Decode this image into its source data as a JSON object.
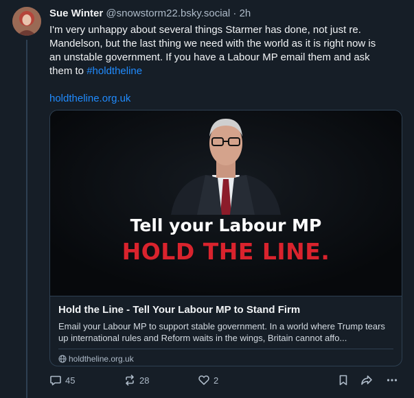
{
  "post": {
    "author_name": "Sue Winter",
    "author_handle": "@snowstorm22.bsky.social",
    "separator": "·",
    "time": "2h",
    "text_line1": "I'm very unhappy about several things Starmer has done, not just re.",
    "text_line2": "Mandelson, but the last thing we need with the world as it is right now is",
    "text_line3": "an unstable government. If you have a Labour MP email them and ask",
    "text_line4_prefix": "them to ",
    "hashtag": "#holdtheline",
    "link": "holdtheline.org.uk"
  },
  "card": {
    "image_line1": "Tell your Labour MP",
    "image_line2": "HOLD THE LINE.",
    "title": "Hold the Line - Tell Your Labour MP to Stand Firm",
    "description": "Email your Labour MP to support stable government. In a world where Trump tears up international rules and Reform waits in the wings, Britain cannot affo...",
    "domain": "holdtheline.org.uk"
  },
  "actions": {
    "replies": "45",
    "reposts": "28",
    "likes": "2"
  },
  "icons": {
    "reply": "reply-icon",
    "repost": "repost-icon",
    "like": "heart-icon",
    "bookmark": "bookmark-icon",
    "share": "share-icon",
    "more": "more-icon",
    "globe": "globe-icon"
  },
  "colors": {
    "background": "#161e27",
    "accent": "#208bfe",
    "image_red": "#d9232d"
  }
}
